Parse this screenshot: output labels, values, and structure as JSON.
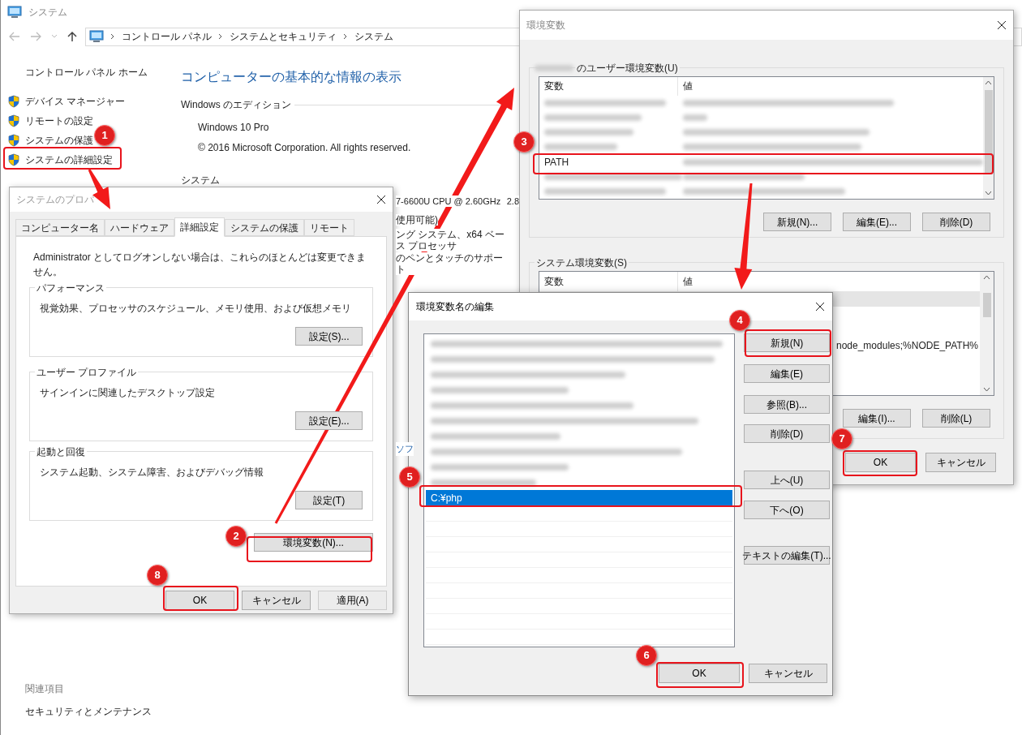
{
  "window": {
    "title": "システム",
    "breadcrumb": [
      "コントロール パネル",
      "システムとセキュリティ",
      "システム"
    ]
  },
  "sidebar": {
    "home": "コントロール パネル ホーム",
    "items": [
      {
        "label": "デバイス マネージャー"
      },
      {
        "label": "リモートの設定"
      },
      {
        "label": "システムの保護"
      },
      {
        "label": "システムの詳細設定"
      }
    ],
    "related_heading": "関連項目",
    "related_links": [
      "セキュリティとメンテナンス"
    ]
  },
  "main": {
    "heading": "コンピューターの基本的な情報の表示",
    "edition_heading": "Windows のエディション",
    "edition": "Windows 10 Pro",
    "copyright": "© 2016 Microsoft Corporation. All rights reserved.",
    "system_heading": "システム",
    "partial_lines": [
      [
        "7-6600U CPU @ 2.60GHz",
        "2.8"
      ],
      [
        "使用可能)"
      ],
      [
        "ング システム、x64 ベース プロセッサ"
      ],
      [
        "のペンとタッチのサポート"
      ]
    ],
    "partial_link": "ソフ"
  },
  "system_properties": {
    "title": "システムのプロパ",
    "tabs": [
      {
        "label": "コンピューター名",
        "selected": false
      },
      {
        "label": "ハードウェア",
        "selected": false
      },
      {
        "label": "詳細設定",
        "selected": true
      },
      {
        "label": "システムの保護",
        "selected": false
      },
      {
        "label": "リモート",
        "selected": false
      }
    ],
    "notice": "Administrator としてログオンしない場合は、これらのほとんどは変更できません。",
    "groups": [
      {
        "title": "パフォーマンス",
        "description": "視覚効果、プロセッサのスケジュール、メモリ使用、および仮想メモリ",
        "button": "設定(S)..."
      },
      {
        "title": "ユーザー プロファイル",
        "description": "サインインに関連したデスクトップ設定",
        "button": "設定(E)..."
      },
      {
        "title": "起動と回復",
        "description": "システム起動、システム障害、およびデバッグ情報",
        "button": "設定(T)"
      }
    ],
    "env_button": "環境変数(N)...",
    "buttons": [
      {
        "label": "OK",
        "disabled": false
      },
      {
        "label": "キャンセル",
        "disabled": false
      },
      {
        "label": "適用(A)",
        "disabled": true
      }
    ]
  },
  "env_vars": {
    "title": "環境変数",
    "user_section": {
      "label": "のユーザー環境変数(U)",
      "columns": [
        "変数",
        "値"
      ],
      "rows": [
        {
          "kind": "redacted"
        },
        {
          "kind": "redacted"
        },
        {
          "kind": "redacted"
        },
        {
          "kind": "redacted"
        },
        {
          "kind": "entry",
          "name": "PATH"
        },
        {
          "kind": "redacted"
        },
        {
          "kind": "redacted"
        }
      ],
      "buttons": [
        "新規(N)...",
        "編集(E)...",
        "削除(D)"
      ]
    },
    "system_section": {
      "label": "システム環境変数(S)",
      "columns": [
        "変数",
        "値"
      ],
      "rows": [
        {
          "kind": "hidden",
          "selected": true
        },
        {
          "kind": "fragment",
          "value": "node_modules;%NODE_PATH%",
          "selected": false
        }
      ],
      "buttons": [
        "編集(I)...",
        "削除(L)"
      ]
    },
    "buttons": [
      "OK",
      "キャンセル"
    ]
  },
  "edit_dialog": {
    "title": "環境変数名の編集",
    "entries": [
      {
        "kind": "redacted",
        "selected": false
      },
      {
        "kind": "redacted",
        "selected": false
      },
      {
        "kind": "redacted",
        "selected": false
      },
      {
        "kind": "redacted",
        "selected": false
      },
      {
        "kind": "redacted",
        "selected": false
      },
      {
        "kind": "redacted",
        "selected": false
      },
      {
        "kind": "redacted",
        "selected": false
      },
      {
        "kind": "redacted",
        "selected": false
      },
      {
        "kind": "redacted",
        "selected": false
      },
      {
        "kind": "redacted",
        "selected": false
      },
      {
        "kind": "entry",
        "text": "C:¥php",
        "selected": true
      }
    ],
    "side_buttons": [
      "新規(N)",
      "編集(E)",
      "参照(B)...",
      "削除(D)",
      "上へ(U)",
      "下へ(O)",
      "テキストの編集(T)..."
    ],
    "buttons": [
      "OK",
      "キャンセル"
    ]
  },
  "annotations": {
    "steps": [
      "1",
      "2",
      "3",
      "4",
      "5",
      "6",
      "7",
      "8"
    ]
  }
}
